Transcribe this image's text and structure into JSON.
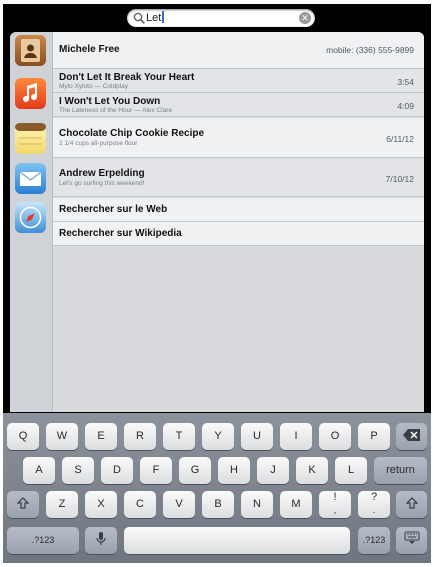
{
  "search": {
    "query": "Let",
    "clear_icon": "clear-icon",
    "icon": "search-icon"
  },
  "results": {
    "contact": {
      "name": "Michele Free",
      "detail": "mobile: (336) 555-9899",
      "icon": "contacts-icon"
    },
    "music": {
      "icon": "music-icon",
      "items": [
        {
          "title": "Don't Let It Break Your Heart",
          "sub": "Mylo Xyloto  —  Coldplay",
          "duration": "3:54"
        },
        {
          "title": "I Won't Let You Down",
          "sub": "The Lateness of the Hour  —  Alex Clare",
          "duration": "4:09"
        }
      ]
    },
    "note": {
      "title": "Chocolate Chip Cookie Recipe",
      "sub": "2 1/4 cups all-purpose flour",
      "date": "6/11/12",
      "icon": "notes-icon"
    },
    "mail": {
      "title": "Andrew Erpelding",
      "sub": "Let's go surfing this weekend!",
      "date": "7/10/12",
      "icon": "mail-icon"
    },
    "web": {
      "items": [
        "Rechercher sur le Web",
        "Rechercher sur Wikipedia"
      ],
      "icon": "safari-icon"
    }
  },
  "keyboard": {
    "row1": [
      "Q",
      "W",
      "E",
      "R",
      "T",
      "Y",
      "U",
      "I",
      "O",
      "P"
    ],
    "row2": [
      "A",
      "S",
      "D",
      "F",
      "G",
      "H",
      "J",
      "K",
      "L"
    ],
    "row3": [
      "Z",
      "X",
      "C",
      "V",
      "B",
      "N",
      "M",
      "!",
      "?"
    ],
    "row3_sub": [
      ",",
      "."
    ],
    "return_label": "return",
    "numbers_label": ".?123"
  }
}
